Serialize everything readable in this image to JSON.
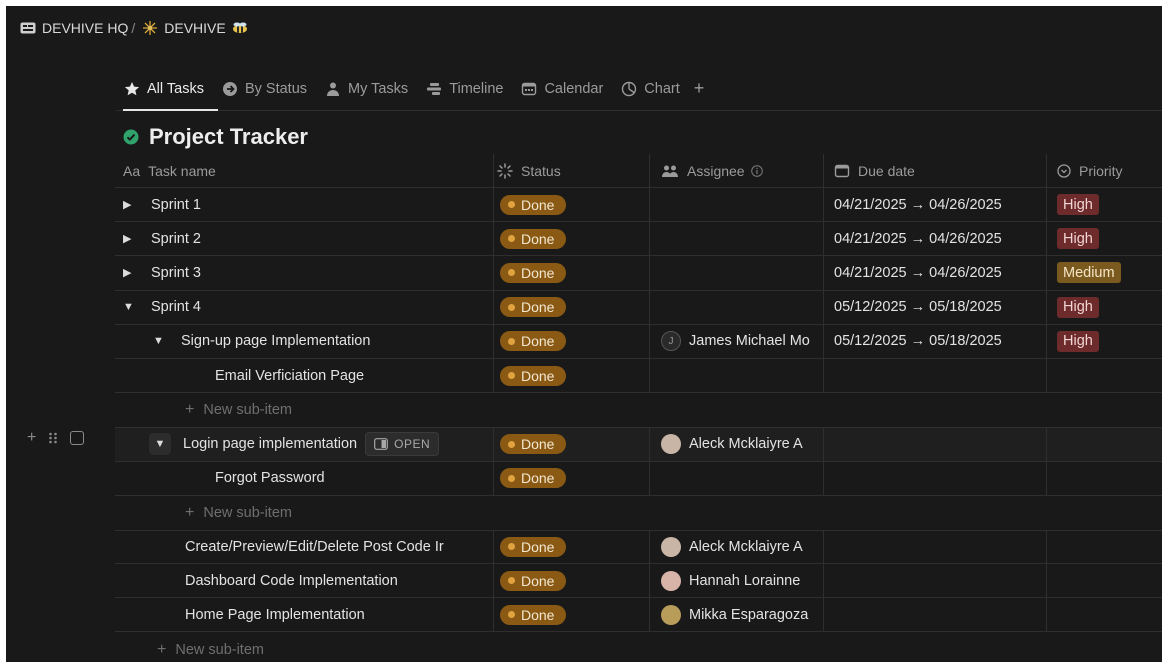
{
  "breadcrumb": {
    "workspace_label": "DEVHIVE HQ",
    "separator": "/",
    "page_label": "DEVHIVE"
  },
  "tabs": [
    {
      "label": "All Tasks",
      "icon": "star-icon",
      "active": true
    },
    {
      "label": "By Status",
      "icon": "arrow-circle-icon",
      "active": false
    },
    {
      "label": "My Tasks",
      "icon": "person-icon",
      "active": false
    },
    {
      "label": "Timeline",
      "icon": "timeline-icon",
      "active": false
    },
    {
      "label": "Calendar",
      "icon": "calendar-icon",
      "active": false
    },
    {
      "label": "Chart",
      "icon": "chart-icon",
      "active": false
    }
  ],
  "tab_add": "+",
  "title": "Project Tracker",
  "columns": {
    "name": "Task name",
    "name_prefix": "Aa",
    "status": "Status",
    "assignee": "Assignee",
    "due": "Due date",
    "priority": "Priority"
  },
  "rows": [
    {
      "name": "Sprint 1",
      "status": "Done",
      "assignee": "",
      "due": "04/21/2025 → 04/26/2025",
      "priority": "High"
    },
    {
      "name": "Sprint 2",
      "status": "Done",
      "assignee": "",
      "due": "04/21/2025 → 04/26/2025",
      "priority": "High"
    },
    {
      "name": "Sprint 3",
      "status": "Done",
      "assignee": "",
      "due": "04/21/2025 → 04/26/2025",
      "priority": "Medium"
    },
    {
      "name": "Sprint 4",
      "status": "Done",
      "assignee": "",
      "due": "05/12/2025 → 05/18/2025",
      "priority": "High"
    },
    {
      "name": "Sign-up page Implementation",
      "status": "Done",
      "assignee": "James Michael Mo",
      "assignee_initial": "J",
      "due": "05/12/2025 → 05/18/2025",
      "priority": "High"
    },
    {
      "name": "Email Verficiation Page",
      "status": "Done"
    },
    {
      "name": "New sub-item"
    },
    {
      "name": "Login page implementation",
      "open_label": "OPEN",
      "status": "Done",
      "assignee": "Aleck Mcklaiyre A"
    },
    {
      "name": "Forgot Password",
      "status": "Done"
    },
    {
      "name": "New sub-item"
    },
    {
      "name": "Create/Preview/Edit/Delete Post Code Ir",
      "status": "Done",
      "assignee": "Aleck Mcklaiyre A"
    },
    {
      "name": "Dashboard Code Implementation",
      "status": "Done",
      "assignee": "Hannah Lorainne"
    },
    {
      "name": "Home Page Implementation",
      "status": "Done",
      "assignee": "Mikka Esparagoza"
    },
    {
      "name": "New sub-item"
    }
  ],
  "colors": {
    "background": "#191919",
    "done_badge": "#8a5a15",
    "high_priority": "#6e2b2b",
    "medium_priority": "#7a5a1e",
    "title_check": "#2fa36b"
  }
}
